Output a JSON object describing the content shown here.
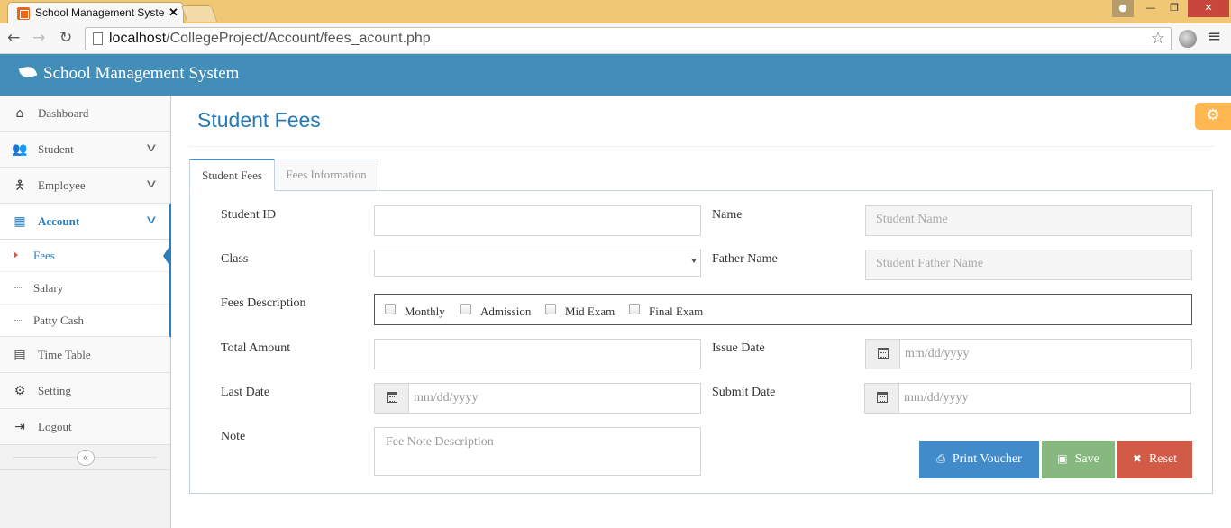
{
  "browser": {
    "tab_title": "School Management Syste",
    "url_host": "localhost",
    "url_path": "/CollegeProject/Account/fees_acount.php"
  },
  "app": {
    "title": "School Management System"
  },
  "sidebar": {
    "items": [
      {
        "label": "Dashboard",
        "icon": "home-icon"
      },
      {
        "label": "Student",
        "icon": "users-icon"
      },
      {
        "label": "Employee",
        "icon": "person-icon"
      },
      {
        "label": "Account",
        "icon": "calculator-icon"
      },
      {
        "label": "Time Table",
        "icon": "calendar-icon"
      },
      {
        "label": "Setting",
        "icon": "gear-icon"
      },
      {
        "label": "Logout",
        "icon": "logout-icon"
      }
    ],
    "account_sub": [
      {
        "label": "Fees"
      },
      {
        "label": "Salary"
      },
      {
        "label": "Patty Cash"
      }
    ]
  },
  "page": {
    "title": "Student Fees",
    "tabs": [
      {
        "label": "Student Fees"
      },
      {
        "label": "Fees Information"
      }
    ]
  },
  "form": {
    "student_id": {
      "label": "Student ID",
      "value": ""
    },
    "name": {
      "label": "Name",
      "placeholder": "Student Name"
    },
    "class": {
      "label": "Class",
      "value": ""
    },
    "father_name": {
      "label": "Father Name",
      "placeholder": "Student Father Name"
    },
    "fees_description": {
      "label": "Fees Description",
      "options": [
        "Monthly",
        "Admission",
        "Mid Exam",
        "Final Exam"
      ]
    },
    "total_amount": {
      "label": "Total Amount",
      "value": ""
    },
    "issue_date": {
      "label": "Issue Date",
      "placeholder": "mm/dd/yyyy"
    },
    "last_date": {
      "label": "Last Date",
      "placeholder": "mm/dd/yyyy"
    },
    "submit_date": {
      "label": "Submit Date",
      "placeholder": "mm/dd/yyyy"
    },
    "note": {
      "label": "Note",
      "placeholder": "Fee Note Description"
    }
  },
  "buttons": {
    "print": "Print Voucher",
    "save": "Save",
    "reset": "Reset"
  },
  "colors": {
    "header": "#438eb9",
    "active": "#2b7dbc",
    "print": "#428bca",
    "save": "#87b87f",
    "reset": "#d15b47",
    "settings": "#ffb752"
  }
}
